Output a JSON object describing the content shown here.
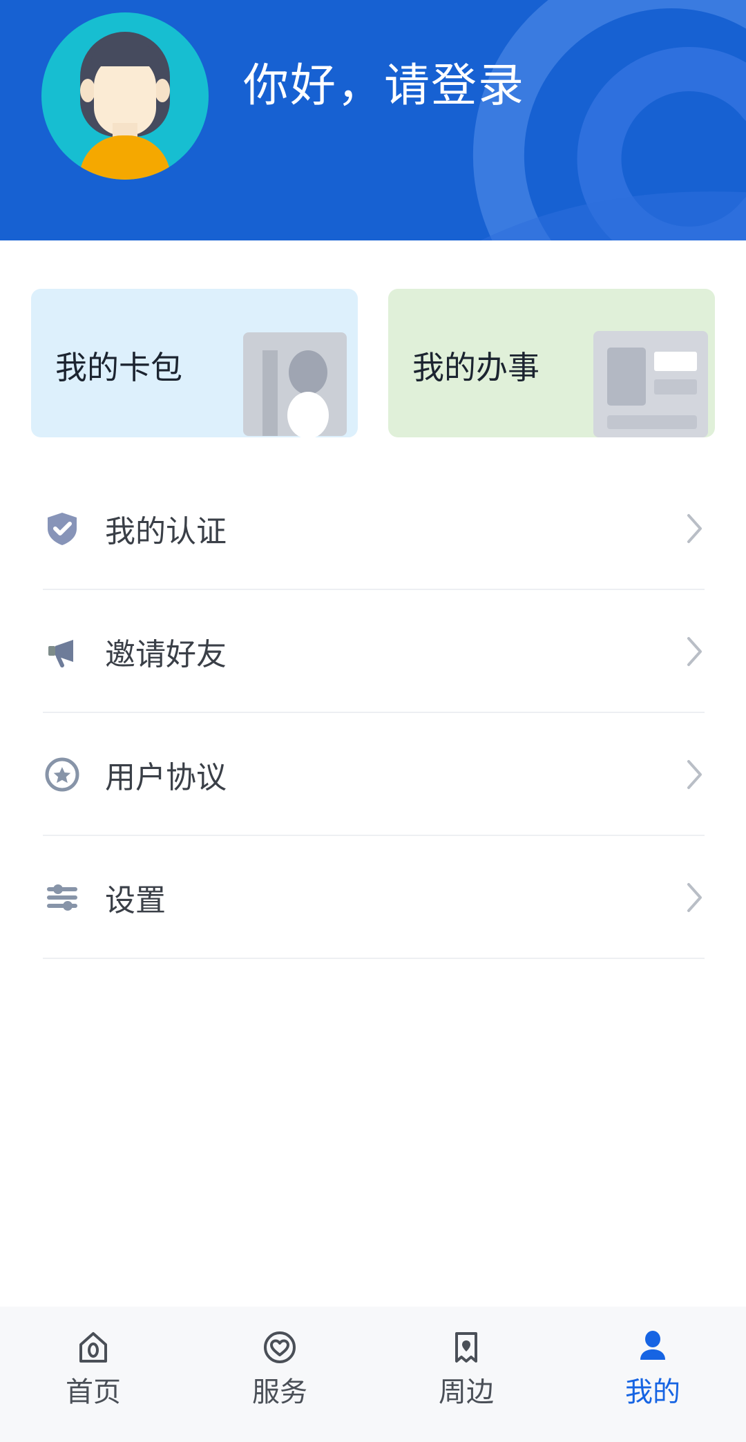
{
  "theme": {
    "header_bg": "#1761D2",
    "page_bg": "#FFFFFF",
    "accent_blue": "#1664E3",
    "card_blue_bg": "#DDF0FC",
    "card_green_bg": "#E0F0D9",
    "text_primary": "#3A3F47",
    "divider": "#EDEFF2",
    "tabbar_bg": "#F7F8FA",
    "icon_grey": "#8794A8",
    "avatar_circle": "#17BED1",
    "avatar_shirt": "#F5A800"
  },
  "header": {
    "greeting": "你好，请登录",
    "avatar_icon": "user-avatar-illustration",
    "decoration_icon": "swirl-background-decoration"
  },
  "quick_cards": [
    {
      "label": "我的卡包",
      "icon": "card-wallet-illustration",
      "bg": "#DDF0FC",
      "name": "my-card-pack"
    },
    {
      "label": "我的办事",
      "icon": "document-form-illustration",
      "bg": "#E0F0D9",
      "name": "my-affairs"
    }
  ],
  "menu": {
    "items": [
      {
        "label": "我的认证",
        "icon": "shield-check-icon",
        "chevron": "chevron-right-icon"
      },
      {
        "label": "邀请好友",
        "icon": "megaphone-icon",
        "chevron": "chevron-right-icon"
      },
      {
        "label": "用户协议",
        "icon": "star-circle-icon",
        "chevron": "chevron-right-icon"
      },
      {
        "label": "设置",
        "icon": "sliders-icon",
        "chevron": "chevron-right-icon"
      }
    ]
  },
  "tabbar": {
    "tabs": [
      {
        "label": "首页",
        "icon": "home-icon",
        "active": false
      },
      {
        "label": "服务",
        "icon": "heart-circle-icon",
        "active": false
      },
      {
        "label": "周边",
        "icon": "map-pin-icon",
        "active": false
      },
      {
        "label": "我的",
        "icon": "person-icon",
        "active": true
      }
    ]
  }
}
